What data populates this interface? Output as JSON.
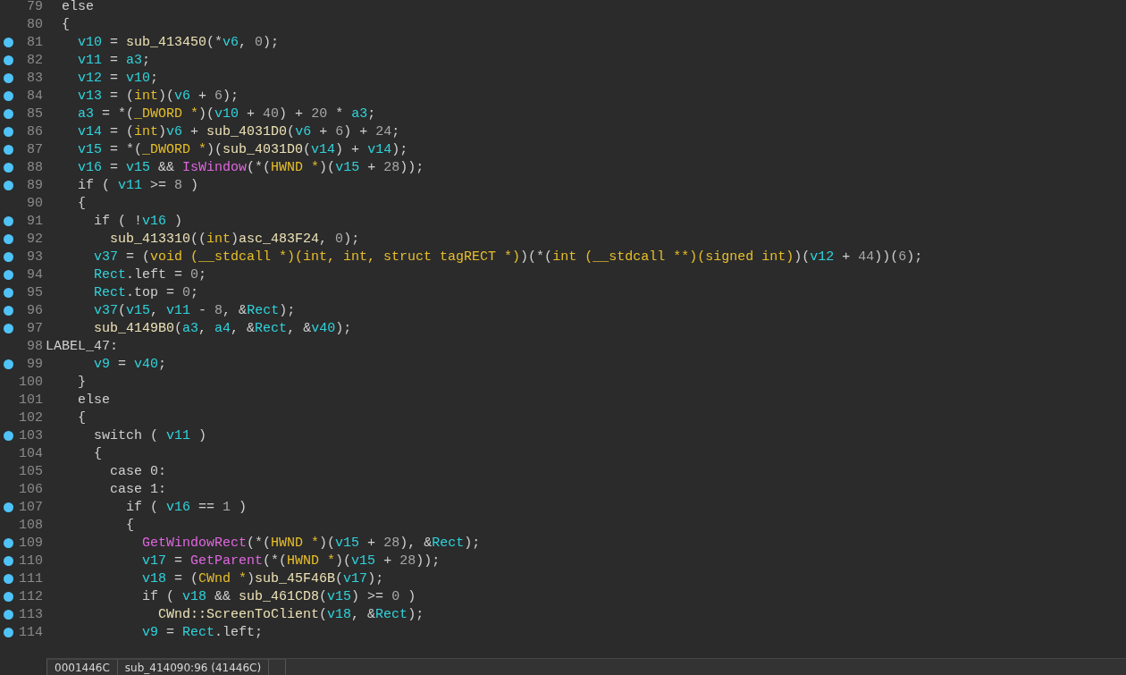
{
  "code_lines": [
    {
      "number": "79",
      "marked": false,
      "tokens": [
        {
          "kind": "p",
          "text": "  else"
        }
      ]
    },
    {
      "number": "80",
      "marked": false,
      "tokens": [
        {
          "kind": "p",
          "text": "  {"
        }
      ]
    },
    {
      "number": "81",
      "marked": true,
      "tokens": [
        {
          "kind": "v",
          "text": "    v10"
        },
        {
          "kind": "p",
          "text": " = "
        },
        {
          "kind": "f",
          "text": "sub_413450"
        },
        {
          "kind": "p",
          "text": "(*"
        },
        {
          "kind": "v",
          "text": "v6"
        },
        {
          "kind": "p",
          "text": ", "
        },
        {
          "kind": "n",
          "text": "0"
        },
        {
          "kind": "p",
          "text": ");"
        }
      ]
    },
    {
      "number": "82",
      "marked": true,
      "tokens": [
        {
          "kind": "v",
          "text": "    v11"
        },
        {
          "kind": "p",
          "text": " = "
        },
        {
          "kind": "v",
          "text": "a3"
        },
        {
          "kind": "p",
          "text": ";"
        }
      ]
    },
    {
      "number": "83",
      "marked": true,
      "tokens": [
        {
          "kind": "v",
          "text": "    v12"
        },
        {
          "kind": "p",
          "text": " = "
        },
        {
          "kind": "v",
          "text": "v10"
        },
        {
          "kind": "p",
          "text": ";"
        }
      ]
    },
    {
      "number": "84",
      "marked": true,
      "tokens": [
        {
          "kind": "v",
          "text": "    v13"
        },
        {
          "kind": "p",
          "text": " = ("
        },
        {
          "kind": "t",
          "text": "int"
        },
        {
          "kind": "p",
          "text": ")("
        },
        {
          "kind": "v",
          "text": "v6"
        },
        {
          "kind": "p",
          "text": " + "
        },
        {
          "kind": "n",
          "text": "6"
        },
        {
          "kind": "p",
          "text": ");"
        }
      ]
    },
    {
      "number": "85",
      "marked": true,
      "tokens": [
        {
          "kind": "v",
          "text": "    a3"
        },
        {
          "kind": "p",
          "text": " = *("
        },
        {
          "kind": "t",
          "text": "_DWORD *"
        },
        {
          "kind": "p",
          "text": ")("
        },
        {
          "kind": "v",
          "text": "v10"
        },
        {
          "kind": "p",
          "text": " + "
        },
        {
          "kind": "n",
          "text": "40"
        },
        {
          "kind": "p",
          "text": ") + "
        },
        {
          "kind": "n",
          "text": "20"
        },
        {
          "kind": "p",
          "text": " * "
        },
        {
          "kind": "v",
          "text": "a3"
        },
        {
          "kind": "p",
          "text": ";"
        }
      ]
    },
    {
      "number": "86",
      "marked": true,
      "tokens": [
        {
          "kind": "v",
          "text": "    v14"
        },
        {
          "kind": "p",
          "text": " = ("
        },
        {
          "kind": "t",
          "text": "int"
        },
        {
          "kind": "p",
          "text": ")"
        },
        {
          "kind": "v",
          "text": "v6"
        },
        {
          "kind": "p",
          "text": " + "
        },
        {
          "kind": "f",
          "text": "sub_4031D0"
        },
        {
          "kind": "p",
          "text": "("
        },
        {
          "kind": "v",
          "text": "v6"
        },
        {
          "kind": "p",
          "text": " + "
        },
        {
          "kind": "n",
          "text": "6"
        },
        {
          "kind": "p",
          "text": ") + "
        },
        {
          "kind": "n",
          "text": "24"
        },
        {
          "kind": "p",
          "text": ";"
        }
      ]
    },
    {
      "number": "87",
      "marked": true,
      "tokens": [
        {
          "kind": "v",
          "text": "    v15"
        },
        {
          "kind": "p",
          "text": " = *("
        },
        {
          "kind": "t",
          "text": "_DWORD *"
        },
        {
          "kind": "p",
          "text": ")("
        },
        {
          "kind": "f",
          "text": "sub_4031D0"
        },
        {
          "kind": "p",
          "text": "("
        },
        {
          "kind": "v",
          "text": "v14"
        },
        {
          "kind": "p",
          "text": ") + "
        },
        {
          "kind": "v",
          "text": "v14"
        },
        {
          "kind": "p",
          "text": ");"
        }
      ]
    },
    {
      "number": "88",
      "marked": true,
      "tokens": [
        {
          "kind": "v",
          "text": "    v16"
        },
        {
          "kind": "p",
          "text": " = "
        },
        {
          "kind": "v",
          "text": "v15"
        },
        {
          "kind": "p",
          "text": " && "
        },
        {
          "kind": "a",
          "text": "IsWindow"
        },
        {
          "kind": "p",
          "text": "(*("
        },
        {
          "kind": "t",
          "text": "HWND *"
        },
        {
          "kind": "p",
          "text": ")("
        },
        {
          "kind": "v",
          "text": "v15"
        },
        {
          "kind": "p",
          "text": " + "
        },
        {
          "kind": "n",
          "text": "28"
        },
        {
          "kind": "p",
          "text": "));"
        }
      ]
    },
    {
      "number": "89",
      "marked": true,
      "tokens": [
        {
          "kind": "p",
          "text": "    if ( "
        },
        {
          "kind": "v",
          "text": "v11"
        },
        {
          "kind": "p",
          "text": " >= "
        },
        {
          "kind": "n",
          "text": "8"
        },
        {
          "kind": "p",
          "text": " )"
        }
      ]
    },
    {
      "number": "90",
      "marked": false,
      "tokens": [
        {
          "kind": "p",
          "text": "    {"
        }
      ]
    },
    {
      "number": "91",
      "marked": true,
      "tokens": [
        {
          "kind": "p",
          "text": "      if ( !"
        },
        {
          "kind": "v",
          "text": "v16"
        },
        {
          "kind": "p",
          "text": " )"
        }
      ]
    },
    {
      "number": "92",
      "marked": true,
      "tokens": [
        {
          "kind": "f",
          "text": "        sub_413310"
        },
        {
          "kind": "p",
          "text": "(("
        },
        {
          "kind": "t",
          "text": "int"
        },
        {
          "kind": "p",
          "text": ")"
        },
        {
          "kind": "f",
          "text": "asc_483F24"
        },
        {
          "kind": "p",
          "text": ", "
        },
        {
          "kind": "n",
          "text": "0"
        },
        {
          "kind": "p",
          "text": ");"
        }
      ]
    },
    {
      "number": "93",
      "marked": true,
      "tokens": [
        {
          "kind": "v",
          "text": "      v37"
        },
        {
          "kind": "p",
          "text": " = ("
        },
        {
          "kind": "t",
          "text": "void (__stdcall *)(int, int, struct tagRECT *)"
        },
        {
          "kind": "p",
          "text": ")(*("
        },
        {
          "kind": "t",
          "text": "int (__stdcall **)(signed int)"
        },
        {
          "kind": "p",
          "text": ")("
        },
        {
          "kind": "v",
          "text": "v12"
        },
        {
          "kind": "p",
          "text": " + "
        },
        {
          "kind": "n",
          "text": "44"
        },
        {
          "kind": "p",
          "text": "))("
        },
        {
          "kind": "n",
          "text": "6"
        },
        {
          "kind": "p",
          "text": ");"
        }
      ]
    },
    {
      "number": "94",
      "marked": true,
      "tokens": [
        {
          "kind": "v",
          "text": "      Rect"
        },
        {
          "kind": "p",
          "text": ".left = "
        },
        {
          "kind": "n",
          "text": "0"
        },
        {
          "kind": "p",
          "text": ";"
        }
      ]
    },
    {
      "number": "95",
      "marked": true,
      "tokens": [
        {
          "kind": "v",
          "text": "      Rect"
        },
        {
          "kind": "p",
          "text": ".top = "
        },
        {
          "kind": "n",
          "text": "0"
        },
        {
          "kind": "p",
          "text": ";"
        }
      ]
    },
    {
      "number": "96",
      "marked": true,
      "tokens": [
        {
          "kind": "v",
          "text": "      v37"
        },
        {
          "kind": "p",
          "text": "("
        },
        {
          "kind": "v",
          "text": "v15"
        },
        {
          "kind": "p",
          "text": ", "
        },
        {
          "kind": "v",
          "text": "v11"
        },
        {
          "kind": "p",
          "text": " - "
        },
        {
          "kind": "n",
          "text": "8"
        },
        {
          "kind": "p",
          "text": ", &"
        },
        {
          "kind": "v",
          "text": "Rect"
        },
        {
          "kind": "p",
          "text": ");"
        }
      ]
    },
    {
      "number": "97",
      "marked": true,
      "tokens": [
        {
          "kind": "f",
          "text": "      sub_4149B0"
        },
        {
          "kind": "p",
          "text": "("
        },
        {
          "kind": "v",
          "text": "a3"
        },
        {
          "kind": "p",
          "text": ", "
        },
        {
          "kind": "v",
          "text": "a4"
        },
        {
          "kind": "p",
          "text": ", &"
        },
        {
          "kind": "v",
          "text": "Rect"
        },
        {
          "kind": "p",
          "text": ", &"
        },
        {
          "kind": "v",
          "text": "v40"
        },
        {
          "kind": "p",
          "text": ");"
        }
      ]
    },
    {
      "number": "98",
      "marked": false,
      "tokens": [
        {
          "kind": "p",
          "text": "LABEL_47:"
        }
      ]
    },
    {
      "number": "99",
      "marked": true,
      "tokens": [
        {
          "kind": "v",
          "text": "      v9"
        },
        {
          "kind": "p",
          "text": " = "
        },
        {
          "kind": "v",
          "text": "v40"
        },
        {
          "kind": "p",
          "text": ";"
        }
      ]
    },
    {
      "number": "100",
      "marked": false,
      "tokens": [
        {
          "kind": "p",
          "text": "    }"
        }
      ]
    },
    {
      "number": "101",
      "marked": false,
      "tokens": [
        {
          "kind": "p",
          "text": "    else"
        }
      ]
    },
    {
      "number": "102",
      "marked": false,
      "tokens": [
        {
          "kind": "p",
          "text": "    {"
        }
      ]
    },
    {
      "number": "103",
      "marked": true,
      "tokens": [
        {
          "kind": "p",
          "text": "      switch ( "
        },
        {
          "kind": "v",
          "text": "v11"
        },
        {
          "kind": "p",
          "text": " )"
        }
      ]
    },
    {
      "number": "104",
      "marked": false,
      "tokens": [
        {
          "kind": "p",
          "text": "      {"
        }
      ]
    },
    {
      "number": "105",
      "marked": false,
      "tokens": [
        {
          "kind": "p",
          "text": "        case 0:"
        }
      ]
    },
    {
      "number": "106",
      "marked": false,
      "tokens": [
        {
          "kind": "p",
          "text": "        case 1:"
        }
      ]
    },
    {
      "number": "107",
      "marked": true,
      "tokens": [
        {
          "kind": "p",
          "text": "          if ( "
        },
        {
          "kind": "v",
          "text": "v16"
        },
        {
          "kind": "p",
          "text": " == "
        },
        {
          "kind": "n",
          "text": "1"
        },
        {
          "kind": "p",
          "text": " )"
        }
      ]
    },
    {
      "number": "108",
      "marked": false,
      "tokens": [
        {
          "kind": "p",
          "text": "          {"
        }
      ]
    },
    {
      "number": "109",
      "marked": true,
      "tokens": [
        {
          "kind": "a",
          "text": "            GetWindowRect"
        },
        {
          "kind": "p",
          "text": "(*("
        },
        {
          "kind": "t",
          "text": "HWND *"
        },
        {
          "kind": "p",
          "text": ")("
        },
        {
          "kind": "v",
          "text": "v15"
        },
        {
          "kind": "p",
          "text": " + "
        },
        {
          "kind": "n",
          "text": "28"
        },
        {
          "kind": "p",
          "text": "), &"
        },
        {
          "kind": "v",
          "text": "Rect"
        },
        {
          "kind": "p",
          "text": ");"
        }
      ]
    },
    {
      "number": "110",
      "marked": true,
      "tokens": [
        {
          "kind": "v",
          "text": "            v17"
        },
        {
          "kind": "p",
          "text": " = "
        },
        {
          "kind": "a",
          "text": "GetParent"
        },
        {
          "kind": "p",
          "text": "(*("
        },
        {
          "kind": "t",
          "text": "HWND *"
        },
        {
          "kind": "p",
          "text": ")("
        },
        {
          "kind": "v",
          "text": "v15"
        },
        {
          "kind": "p",
          "text": " + "
        },
        {
          "kind": "n",
          "text": "28"
        },
        {
          "kind": "p",
          "text": "));"
        }
      ]
    },
    {
      "number": "111",
      "marked": true,
      "tokens": [
        {
          "kind": "v",
          "text": "            v18"
        },
        {
          "kind": "p",
          "text": " = ("
        },
        {
          "kind": "t",
          "text": "CWnd *"
        },
        {
          "kind": "p",
          "text": ")"
        },
        {
          "kind": "f",
          "text": "sub_45F46B"
        },
        {
          "kind": "p",
          "text": "("
        },
        {
          "kind": "v",
          "text": "v17"
        },
        {
          "kind": "p",
          "text": ");"
        }
      ]
    },
    {
      "number": "112",
      "marked": true,
      "tokens": [
        {
          "kind": "p",
          "text": "            if ( "
        },
        {
          "kind": "v",
          "text": "v18"
        },
        {
          "kind": "p",
          "text": " && "
        },
        {
          "kind": "f",
          "text": "sub_461CD8"
        },
        {
          "kind": "p",
          "text": "("
        },
        {
          "kind": "v",
          "text": "v15"
        },
        {
          "kind": "p",
          "text": ") >= "
        },
        {
          "kind": "n",
          "text": "0"
        },
        {
          "kind": "p",
          "text": " )"
        }
      ]
    },
    {
      "number": "113",
      "marked": true,
      "tokens": [
        {
          "kind": "f",
          "text": "              CWnd::ScreenToClient"
        },
        {
          "kind": "p",
          "text": "("
        },
        {
          "kind": "v",
          "text": "v18"
        },
        {
          "kind": "p",
          "text": ", &"
        },
        {
          "kind": "v",
          "text": "Rect"
        },
        {
          "kind": "p",
          "text": ");"
        }
      ]
    },
    {
      "number": "114",
      "marked": true,
      "tokens": [
        {
          "kind": "v",
          "text": "            v9"
        },
        {
          "kind": "p",
          "text": " = "
        },
        {
          "kind": "v",
          "text": "Rect"
        },
        {
          "kind": "p",
          "text": ".left;"
        }
      ]
    }
  ],
  "status_bar": [
    "0001446C",
    "sub_414090:96 (41446C)"
  ]
}
